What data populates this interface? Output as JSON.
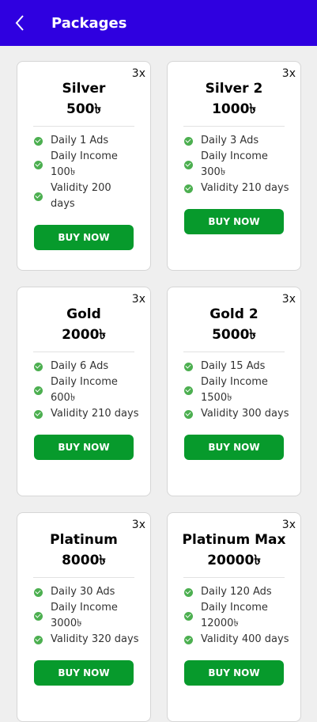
{
  "header": {
    "title": "Packages",
    "back_icon": "chevron-left-icon",
    "bg_color": "#2f00e0"
  },
  "colors": {
    "button": "#079a2c",
    "check": "#4caf50"
  },
  "packages": [
    {
      "multiplier": "3x",
      "name": "Silver",
      "price": "500৳",
      "features": [
        "Daily 1 Ads",
        "Daily Income 100৳",
        "Validity 200 days"
      ],
      "button_label": "BUY NOW"
    },
    {
      "multiplier": "3x",
      "name": "Silver 2",
      "price": "1000৳",
      "features": [
        "Daily 3 Ads",
        "Daily Income 300৳",
        "Validity 210 days"
      ],
      "button_label": "BUY NOW"
    },
    {
      "multiplier": "3x",
      "name": "Gold",
      "price": "2000৳",
      "features": [
        "Daily 6 Ads",
        "Daily Income 600৳",
        "Validity 210 days"
      ],
      "button_label": "BUY NOW"
    },
    {
      "multiplier": "3x",
      "name": "Gold 2",
      "price": "5000৳",
      "features": [
        "Daily 15 Ads",
        "Daily Income 1500৳",
        "Validity 300 days"
      ],
      "button_label": "BUY NOW"
    },
    {
      "multiplier": "3x",
      "name": "Platinum",
      "price": "8000৳",
      "features": [
        "Daily 30 Ads",
        "Daily Income 3000৳",
        "Validity 320 days"
      ],
      "button_label": "BUY NOW"
    },
    {
      "multiplier": "3x",
      "name": "Platinum Max",
      "price": "20000৳",
      "features": [
        "Daily 120 Ads",
        "Daily Income 12000৳",
        "Validity 400 days"
      ],
      "button_label": "BUY NOW"
    }
  ]
}
